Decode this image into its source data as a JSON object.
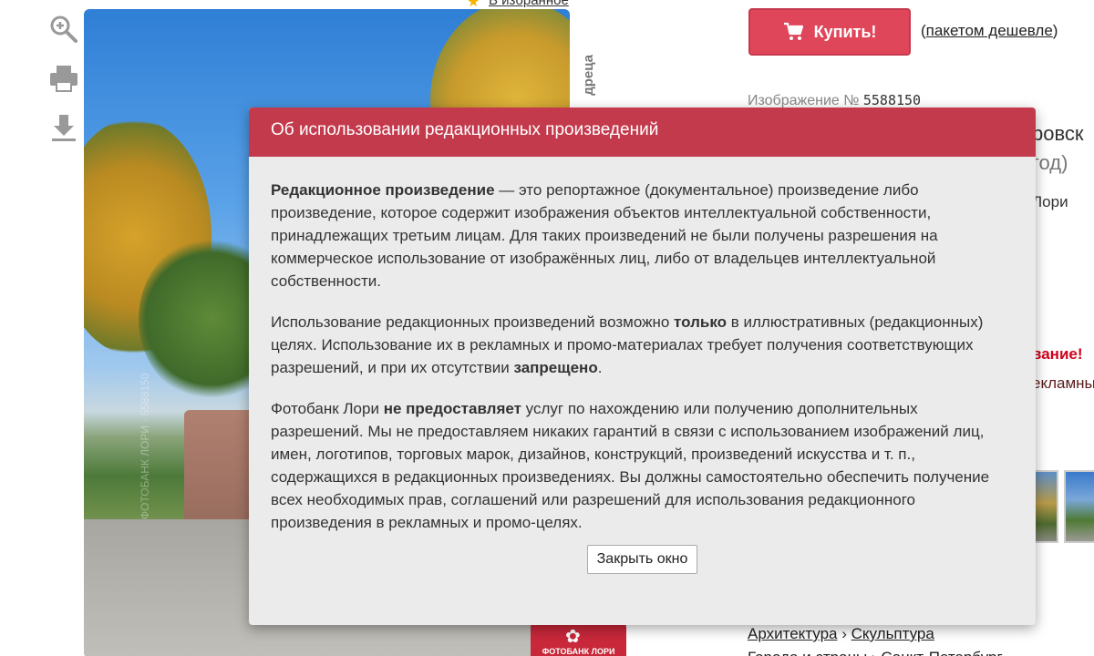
{
  "toolbar": {
    "zoom_icon": "zoom-in-icon",
    "print_icon": "printer-icon",
    "download_icon": "download-icon"
  },
  "favorites": {
    "label": "В избранное"
  },
  "buy": {
    "label": "Купить!",
    "icon": "cart-icon",
    "bundle_link": "пакетом дешевле",
    "bundle_open": "(",
    "bundle_close": ")"
  },
  "image_info": {
    "label": "Изображение №",
    "number": "5588150"
  },
  "photo": {
    "side_caption": "дреца",
    "logo_text": "ФОТОБАНК ЛОРИ",
    "watermark": "ФОТОБАНК ЛОРИ · 5588150"
  },
  "partial_right": {
    "title_fragment": "ровск",
    "year_fragment": "год)",
    "author_fragment": "Лори",
    "warning_fragment": "вание!",
    "warning_sub_fragment": "екламны"
  },
  "breadcrumb": {
    "item1": "Архитектура",
    "separator": "›",
    "item2": "Скульптура",
    "line2_item1": "Города и страны",
    "line2_item2": "Санкт-Петербург"
  },
  "modal": {
    "title": "Об использовании редакционных произведений",
    "p1_bold": "Редакционное произведение",
    "p1_text": " — это репортажное (документальное) произведение либо произведение, которое содержит изображения объектов интеллектуальной собственности, принадлежащих третьим лицам. Для таких произведений не были получены разрешения на коммерческое использование от изображённых лиц, либо от владельцев интеллектуальной собственности.",
    "p2_text1": "Использование редакционных произведений возможно ",
    "p2_bold1": "только",
    "p2_text2": " в иллюстративных (редакционных) целях. Использование их в рекламных и промо-материалах требует получения соответствующих разрешений, и при их отсутствии ",
    "p2_bold2": "запрещено",
    "p2_text3": ".",
    "p3_text1": "Фотобанк Лори ",
    "p3_bold": "не предоставляет",
    "p3_text2": " услуг по нахождению или получению дополнительных разрешений. Мы не предоставляем никаких гарантий в связи с использованием изображений лиц, имен, логотипов, торговых марок, дизайнов, конструкций, произведений искусства и т. п., содержащихся в редакционных произведениях. Вы должны самостоятельно обеспечить получение всех необходимых прав, соглашений или разрешений для использования редакционного произведения в рекламных и промо-целях.",
    "close_label": "Закрыть окно"
  },
  "colors": {
    "accent": "#c43a4d",
    "buy_button": "#e0465a",
    "warning": "#d0021b"
  }
}
